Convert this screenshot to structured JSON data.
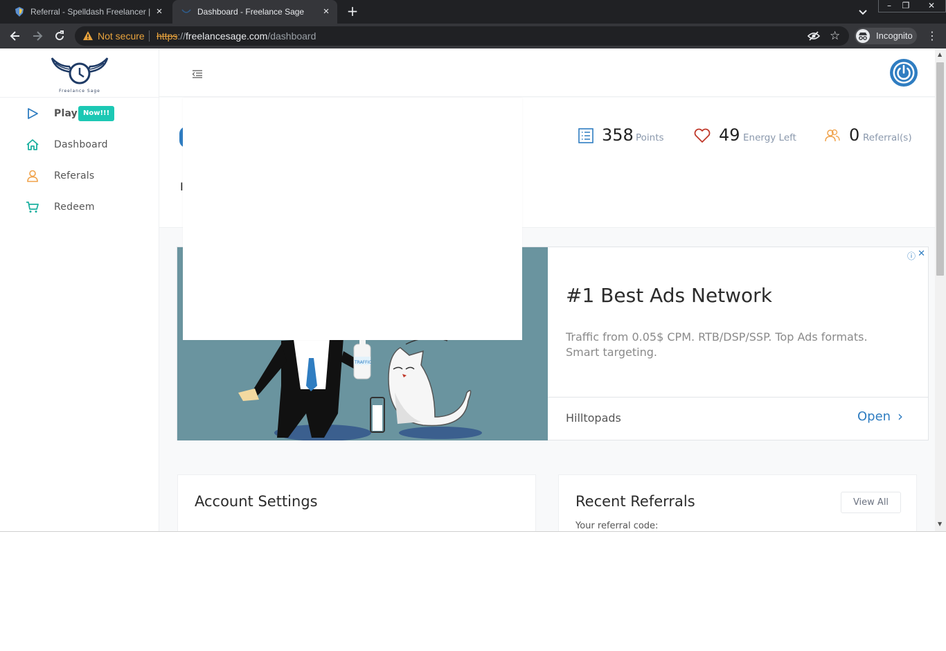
{
  "browser": {
    "tabs": [
      {
        "title": "Referral - Spelldash Freelancer | Pa",
        "favicon": "shield-favicon",
        "active": false
      },
      {
        "title": "Dashboard - Freelance Sage",
        "favicon": "wings-favicon",
        "active": true
      }
    ],
    "new_tab_symbol": "+",
    "window_controls": {
      "minimize": "–",
      "maximize": "❐",
      "close": "✕"
    },
    "security_label": "Not secure",
    "url_scheme": "https",
    "url_sep": "://",
    "url_host": "freelancesage.com",
    "url_path": "/dashboard",
    "profile_label": "Incognito",
    "menu_symbol": "⋮"
  },
  "sidebar": {
    "logo_text": "Freelance Sage",
    "items": [
      {
        "label": "Play",
        "badge": "Now!!!",
        "icon": "play-icon"
      },
      {
        "label": "Dashboard",
        "icon": "home-icon"
      },
      {
        "label": "Referals",
        "icon": "user-icon"
      },
      {
        "label": "Redeem",
        "icon": "cart-icon"
      }
    ]
  },
  "stats": {
    "points_value": "358",
    "points_label": "Points",
    "energy_value": "49",
    "energy_label": "Energy Left",
    "referrals_value": "0",
    "referrals_label": "Referral(s)",
    "partial_glyph": "I"
  },
  "ad": {
    "title": "#1 Best Ads Network",
    "description": "Traffic from 0.05$ CPM. RTB/DSP/SSP. Top Ads formats. Smart targeting.",
    "brand": "Hilltopads",
    "cta": "Open",
    "cta_chevron": "›",
    "info_symbol": "ⓘ",
    "close_symbol": "✕",
    "bottle_label": "TRAFFIC"
  },
  "account_card": {
    "title": "Account Settings"
  },
  "recent_card": {
    "title": "Recent Referrals",
    "view_all": "View All",
    "code_label": "Your referral code:"
  },
  "colors": {
    "accent_blue": "#2f7dc1",
    "badge_teal": "#1cc8b4",
    "energy_red": "#c0392b",
    "referral_orange": "#f0a24a",
    "ad_bg": "#6a949f"
  }
}
